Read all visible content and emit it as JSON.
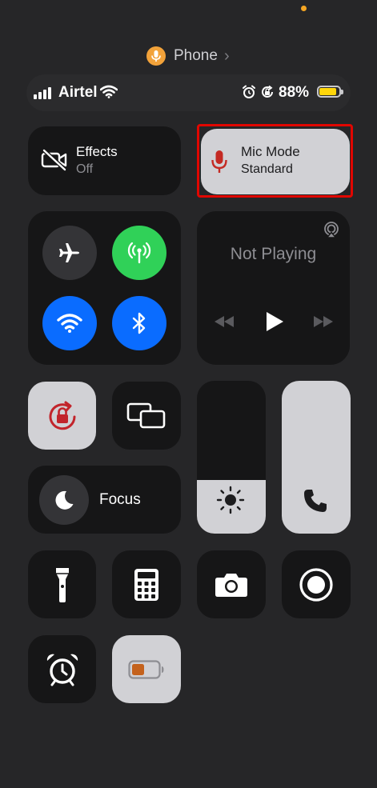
{
  "top_pill": {
    "app_label": "Phone",
    "icons": [
      "microphone-icon",
      "chevron-right-icon"
    ]
  },
  "status_bar": {
    "carrier": "Airtel",
    "battery_percent": "88%",
    "battery_level": 0.88,
    "icons": [
      "cellular-signal-icon",
      "wifi-icon",
      "alarm-icon",
      "rotation-lock-icon",
      "battery-icon"
    ]
  },
  "video_effects": {
    "title": "Effects",
    "status": "Off",
    "icon": "video-slash-icon"
  },
  "mic_mode": {
    "title": "Mic Mode",
    "status": "Standard",
    "icon": "microphone-icon",
    "highlight_color": "#e10600"
  },
  "connectivity": {
    "airplane": {
      "icon": "airplane-icon",
      "on": false
    },
    "cellular": {
      "icon": "cellular-antenna-icon",
      "on": true,
      "color": "#30d158"
    },
    "wifi": {
      "icon": "wifi-icon",
      "on": true,
      "color": "#0a6cff"
    },
    "bluetooth": {
      "icon": "bluetooth-icon",
      "on": true,
      "color": "#0a6cff"
    }
  },
  "now_playing": {
    "title": "Not Playing",
    "icons": [
      "airplay-icon",
      "rewind-icon",
      "play-icon",
      "fast-forward-icon"
    ]
  },
  "orientation_lock": {
    "icon": "rotation-lock-icon",
    "on": true,
    "color": "#c2242b"
  },
  "screen_mirroring": {
    "icon": "screen-mirroring-icon"
  },
  "focus": {
    "label": "Focus",
    "icon": "moon-icon"
  },
  "brightness": {
    "icon": "sun-icon",
    "level": 0.35
  },
  "call_volume": {
    "icon": "phone-icon",
    "level": 1.0
  },
  "controls": [
    "flashlight-icon",
    "calculator-icon",
    "camera-icon",
    "screen-record-icon",
    "alarm-clock-icon",
    "low-power-battery-icon"
  ]
}
